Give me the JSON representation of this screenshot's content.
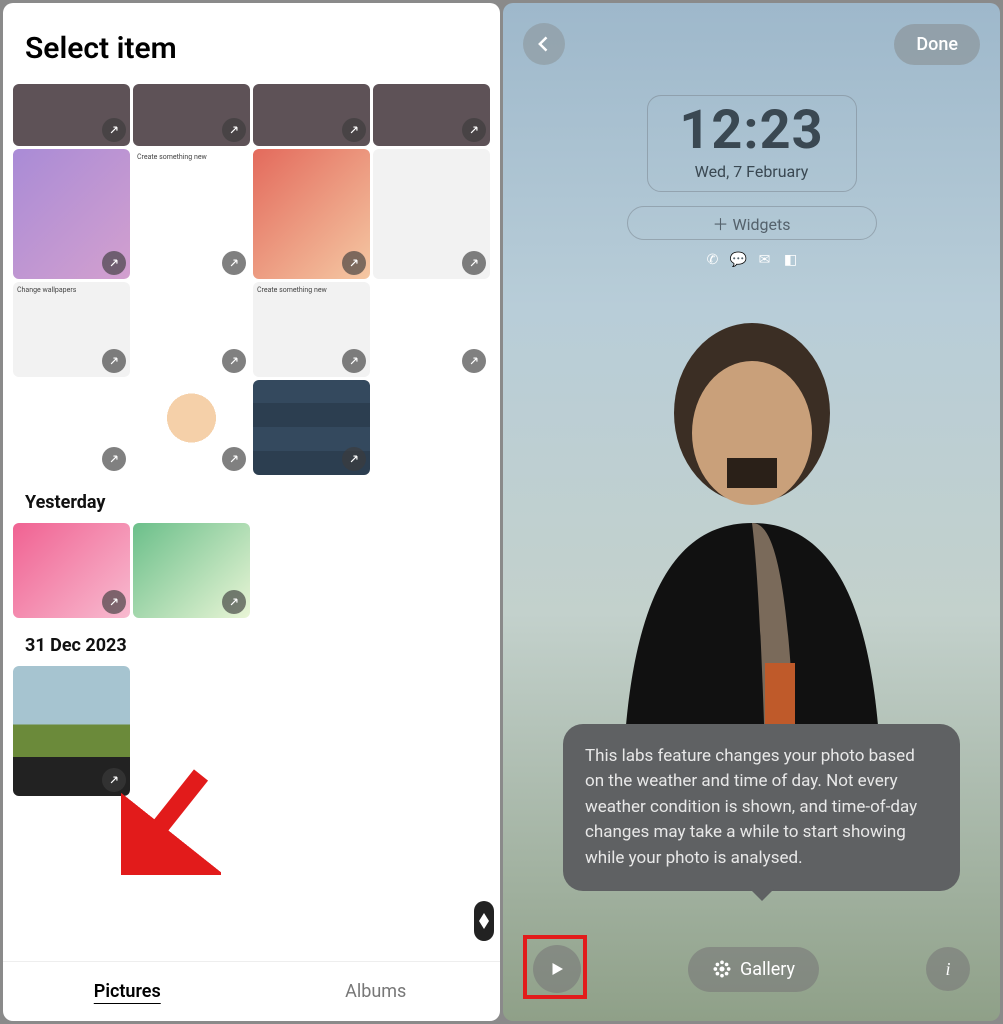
{
  "left": {
    "title": "Select item",
    "sections": {
      "yesterday": "Yesterday",
      "dec31": "31 Dec 2023"
    },
    "tabs": {
      "pictures": "Pictures",
      "albums": "Albums"
    }
  },
  "right": {
    "done": "Done",
    "clock": {
      "time": "12:23",
      "date": "Wed, 7 February"
    },
    "widgets_label": "＋ Widgets",
    "tooltip": "This labs feature changes your photo based on the weather and time of day. Not every weather condition is shown, and time-of-day changes may take a while to start showing while your photo is analysed.",
    "gallery_label": "Gallery",
    "info_label": "i"
  }
}
